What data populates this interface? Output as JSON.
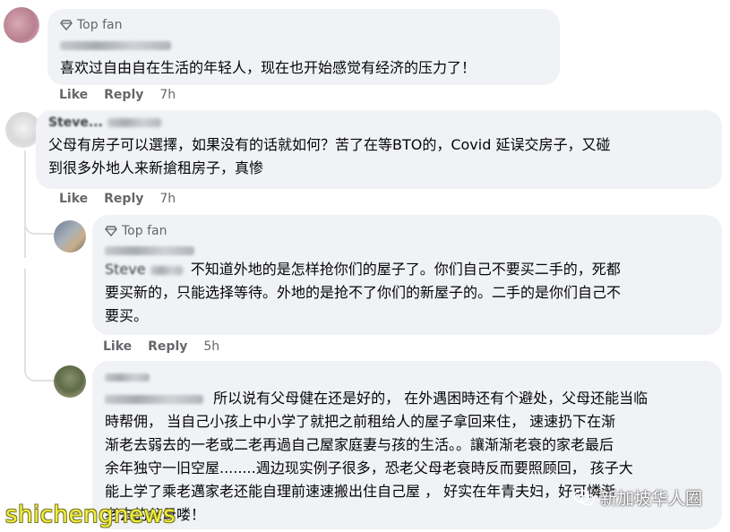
{
  "comments": [
    {
      "badge": "Top fan",
      "text": "喜欢过自由自在生活的年轻人，现在也开始感觉有经济的压力了！",
      "like": "Like",
      "reply": "Reply",
      "time": "7h"
    },
    {
      "name_visible": "Steve...",
      "text_line1": "父母有房子可以選擇，如果没有的话就如何？苦了在等BTO的，Covid 延误交房子，又碰",
      "text_line2": "到很多外地人来新搶租房子，真惨",
      "like": "Like",
      "reply": "Reply",
      "time": "7h"
    },
    {
      "badge": "Top fan",
      "mention": "Steve",
      "text_line1": "不知道外地的是怎样抢你们的屋子了。你们自己不要买二手的，死都",
      "text_line2": "要买新的，只能选择等待。外地的是抢不了你们的新屋子的。二手的是你们自己不",
      "text_line3": "要买。",
      "like": "Like",
      "reply": "Reply",
      "time": "5h"
    },
    {
      "text_line1": "所以说有父母健在还是好的， 在外遇困時还有个避处，父母还能当临",
      "text_line2": "時帮佣， 当自己小孩上中小学了就把之前租给人的屋子拿回来住， 速速扔下在渐",
      "text_line3": "渐老去弱去的一老或二老再過自己屋家庭妻与孩的生活。。讓渐渐老衰的家老最后",
      "text_line4": "余年独守一旧空屋........週边现实例子很多，恐老父母老衰時反而要照顾回， 孩子大",
      "text_line5": "能上学了乘老邁家老还能自理前速速搬出住自己屋 ， 好实在年青夫妇，好可憐渐",
      "text_line6": "老去的父母喽！"
    }
  ],
  "watermarks": {
    "left": "shichengnews",
    "right": "新加坡华人圈"
  }
}
